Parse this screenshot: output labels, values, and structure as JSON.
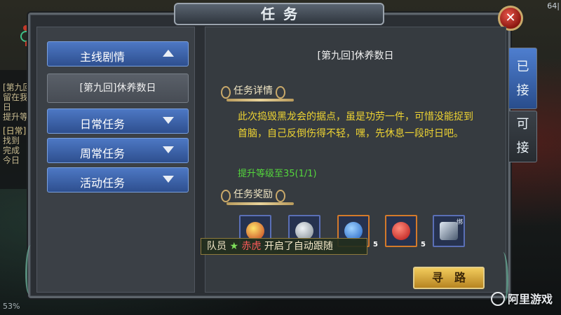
{
  "window": {
    "title": "任务"
  },
  "background": {
    "log_lines": [
      "[第九回",
      "留在我",
      "日",
      "提升等"
    ],
    "log_lines2": [
      "[日常]",
      "找到",
      "完成",
      "今日"
    ],
    "meta_right": "64|",
    "level_text": "53%"
  },
  "categories": [
    {
      "label": "主线剧情",
      "expanded": true
    },
    {
      "label": "日常任务",
      "expanded": false
    },
    {
      "label": "周常任务",
      "expanded": false
    },
    {
      "label": "活动任务",
      "expanded": false
    }
  ],
  "selected_quest": "[第九回]休养数日",
  "quest": {
    "title": "[第九回]休养数日",
    "details_heading": "任务详情",
    "description": "此次捣毁黑龙会的据点，虽是功劳一件，可惜没能捉到首脑，自己反倒伤得不轻，嘿，先休息一段时日吧。",
    "goal": "提升等级至35(1/1)",
    "rewards_heading": "任务奖励",
    "path_button": "寻路"
  },
  "rewards": [
    {
      "icon": "red-orb-item-icon",
      "color": "#d9b42a",
      "count": ""
    },
    {
      "icon": "silver-ore-item-icon",
      "color": "#9aa3ab",
      "count": ""
    },
    {
      "icon": "blue-orb-item-icon",
      "color": "#2d7fe0",
      "count": "5"
    },
    {
      "icon": "red-pill-item-icon",
      "color": "#d22a2a",
      "count": "5"
    },
    {
      "icon": "blade-item-icon",
      "color": "#b8c8d8",
      "count": "",
      "badge": "绑"
    }
  ],
  "side_tabs": [
    {
      "chars": [
        "已",
        "接"
      ],
      "active": true
    },
    {
      "chars": [
        "可",
        "接"
      ],
      "active": false
    }
  ],
  "notice": {
    "prefix": "队员",
    "star": "★",
    "name": "赤虎",
    "suffix": "开启了自动跟随"
  },
  "watermark": "阿里游戏",
  "colors": {
    "accent_blue": "#2e4f8f",
    "quest_text": "#efd432",
    "goal_text": "#54d63c",
    "gold_button": "#f1cb5c"
  }
}
